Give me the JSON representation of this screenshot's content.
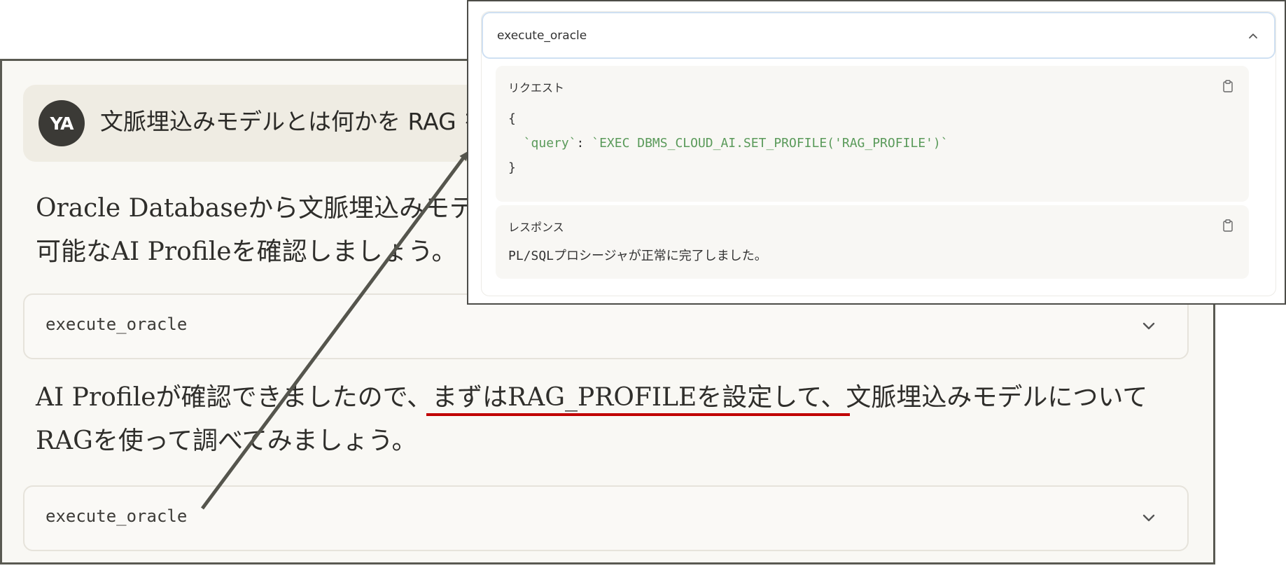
{
  "user_message": {
    "avatar_initials": "YA",
    "text": "文脈埋込みモデルとは何かを RAG を使"
  },
  "assistant": {
    "paragraph_1_line_1": "Oracle Databaseから文脈埋込みモデル",
    "paragraph_1_line_2": "可能なAI Profileを確認しましょう。",
    "paragraph_2_line_1_prefix": "AI Profileが確認できましたので、",
    "paragraph_2_line_1_highlight": "まずはRAG_PROFILEを設定して、",
    "paragraph_2_line_1_suffix": "文脈埋込みモデルについて",
    "paragraph_2_line_2": "RAGを使って調べてみましょう。"
  },
  "tool_cards": [
    {
      "name": "execute_oracle",
      "icon": "chevron-down-icon"
    },
    {
      "name": "execute_oracle",
      "icon": "chevron-down-icon"
    }
  ],
  "popup": {
    "tool_name": "execute_oracle",
    "header_icon": "chevron-up-icon",
    "request": {
      "title": "リクエスト",
      "code_open": "{",
      "code_key": "`query`",
      "code_sep": ": ",
      "code_value": "`EXEC DBMS_CLOUD_AI.SET_PROFILE('RAG_PROFILE')`",
      "code_close": "}"
    },
    "response": {
      "title": "レスポンス",
      "text": "PL/SQLプロシージャが正常に完了しました。"
    }
  },
  "colors": {
    "highlight_underline": "#c00000",
    "code_string": "#5a9a5a",
    "arrow": "#55554d"
  }
}
